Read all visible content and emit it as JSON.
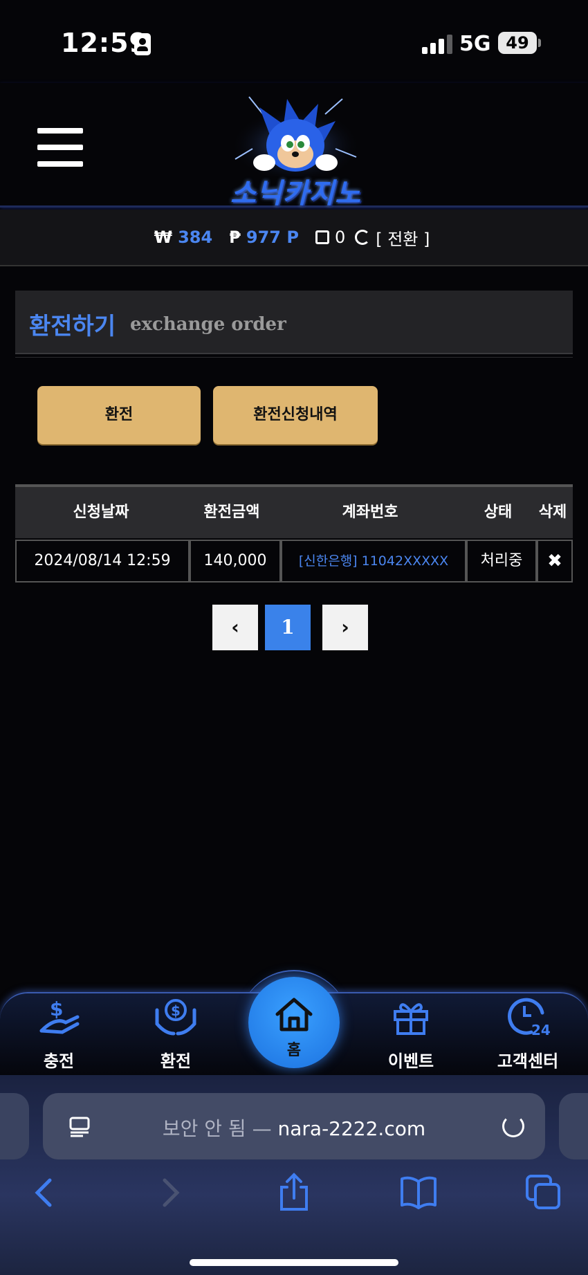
{
  "status_bar": {
    "time": "12:59",
    "network": "5G",
    "battery": "49"
  },
  "header": {
    "logo_text": "소닉카지노"
  },
  "balance": {
    "won_symbol": "₩",
    "won_value": "384",
    "point_symbol": "₱",
    "point_value": "977 P",
    "chip_value": "0",
    "convert_label": "[ 전환 ]"
  },
  "page": {
    "title_ko": "환전하기",
    "title_en": "exchange order"
  },
  "buttons": {
    "exchange": "환전",
    "history": "환전신청내역"
  },
  "table": {
    "headers": [
      "신청날짜",
      "환전금액",
      "계좌번호",
      "상태",
      "삭제"
    ],
    "rows": [
      {
        "date": "2024/08/14 12:59",
        "amount": "140,000",
        "account": "[신한은행] 11042XXXXX",
        "status": "처리중",
        "delete": "✖"
      }
    ]
  },
  "pagination": {
    "prev": "‹",
    "current": "1",
    "next": "›"
  },
  "bottom_nav": {
    "items": [
      {
        "label": "충전",
        "icon": "hand-coin-icon"
      },
      {
        "label": "환전",
        "icon": "hands-dollar-icon"
      },
      {
        "label": "홈",
        "icon": "home-icon"
      },
      {
        "label": "이벤트",
        "icon": "gift-icon"
      },
      {
        "label": "고객센터",
        "icon": "support-24-icon"
      }
    ]
  },
  "browser": {
    "url_prefix": "보안 안 됨 — ",
    "url_domain": "nara-2222.com"
  }
}
